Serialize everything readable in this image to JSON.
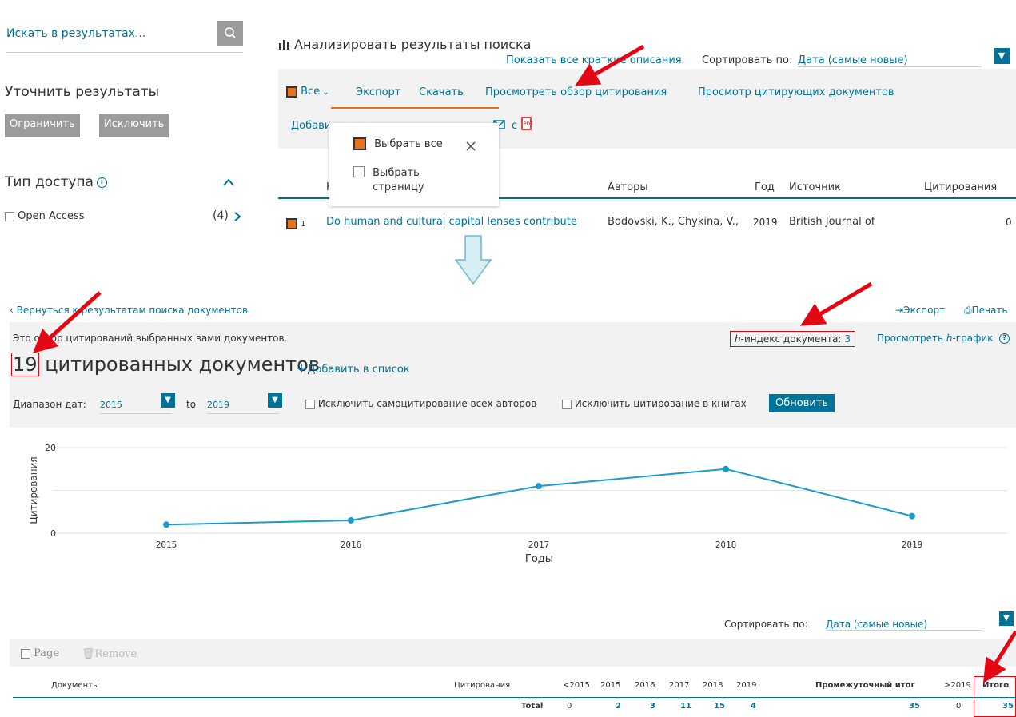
{
  "sidebar": {
    "search_placeholder": "Искать в результатах...",
    "refine_title": "Уточнить результаты",
    "limit_btn": "Ограничить",
    "exclude_btn": "Исключить",
    "access_title": "Тип доступа",
    "open_access_label": "Open Access",
    "open_access_count": "(4)"
  },
  "results": {
    "analyze_label": "Анализировать результаты поиска",
    "show_abstracts": "Показать все краткие описания",
    "sort_label": "Сортировать по:",
    "sort_value": "Дата (самые новые)",
    "all_label": "Все",
    "export": "Экспорт",
    "download": "Скачать",
    "view_citation_overview": "Просмотреть обзор цитирования",
    "view_citing_docs": "Просмотр цитирующих документов",
    "add_to_list_partial": "Добави",
    "add_to_list_partial2": "с",
    "dropdown": {
      "select_all": "Выбрать все",
      "select_page_1": "Выбрать",
      "select_page_2": "страницу"
    },
    "headers": {
      "title_partial": "Н",
      "authors": "Авторы",
      "year": "Год",
      "source": "Источник",
      "citations": "Цитирования"
    },
    "row": {
      "num": "1",
      "title": "Do human and cultural capital lenses contribute",
      "authors": "Bodovski, K., Chykina, V.,",
      "year": "2019",
      "source": "British Journal of",
      "citations": "0"
    }
  },
  "overview": {
    "back_link": "Вернуться к результатам поиска документов",
    "export": "Экспорт",
    "print": "Печать",
    "intro": "Это обзор цитирований выбранных вами документов.",
    "h_index_label": "-индекс документа:",
    "h_index_value": "3",
    "h_italic": "h",
    "view_h_graph_pre": "Просмотреть",
    "view_h_graph_post": "-график",
    "doc_count": "19",
    "doc_count_label": "цитированных документов",
    "add_to_list": "Добавить в список",
    "date_range_label": "Диапазон дат:",
    "date_from": "2015",
    "date_to_label": "to",
    "date_to": "2019",
    "exclude_self": "Исключить самоцитирование всех авторов",
    "exclude_books": "Исключить цитирование в книгах",
    "update_btn": "Обновить"
  },
  "chart_data": {
    "type": "line",
    "x": [
      "2015",
      "2016",
      "2017",
      "2018",
      "2019"
    ],
    "values": [
      2,
      3,
      11,
      15,
      4
    ],
    "xlabel": "Годы",
    "ylabel": "Цитирования",
    "ylim": [
      0,
      20
    ],
    "yticks": [
      "0",
      "20"
    ],
    "color": "#1a9bcc",
    "grid": true
  },
  "table": {
    "sort_label": "Сортировать по:",
    "sort_value": "Дата (самые новые)",
    "page_label": "Page",
    "remove_label": "Remove",
    "headers": {
      "documents": "Документы",
      "citations": "Цитирования",
      "lt2015": "<2015",
      "y2015": "2015",
      "y2016": "2016",
      "y2017": "2017",
      "y2018": "2018",
      "y2019": "2019",
      "subtotal": "Промежуточный итог",
      "gt2019": ">2019",
      "total": "Итого"
    },
    "total_row": {
      "label": "Total",
      "lt2015": "0",
      "y2015": "2",
      "y2016": "3",
      "y2017": "11",
      "y2018": "15",
      "y2019": "4",
      "subtotal": "35",
      "gt2019": "0",
      "total": "35"
    }
  },
  "colors": {
    "accent": "#007398",
    "orange": "#e9711c",
    "annotation_red": "#e30613"
  }
}
